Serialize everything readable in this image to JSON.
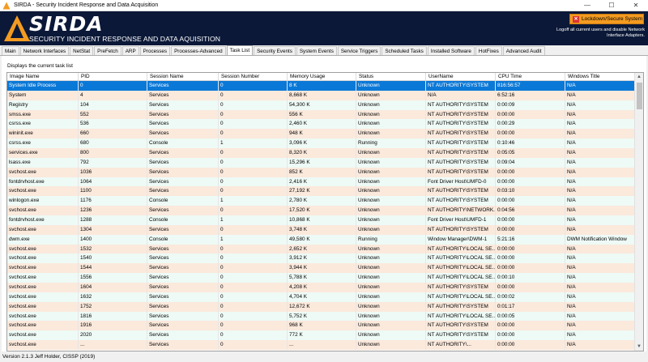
{
  "window": {
    "title": "SIRDA - Security Incident Response and Data Acquisition",
    "minimize": "—",
    "maximize": "☐",
    "close": "✕"
  },
  "banner": {
    "brand": "SIRDA",
    "subtitle": "SECURITY INCIDENT RESPONSE AND DATA AQUISITION",
    "lockdown_label": "Lockdown/Secure System",
    "lockdown_note": "Logoff all current users and disable Network Interface Adapters.",
    "colors": {
      "background": "#0b1838",
      "logo": "#f39b21",
      "lockdown": "#f39b21"
    }
  },
  "tabs": [
    {
      "label": "Main"
    },
    {
      "label": "Network Interfaces"
    },
    {
      "label": "NetStat"
    },
    {
      "label": "PreFetch"
    },
    {
      "label": "ARP"
    },
    {
      "label": "Processes"
    },
    {
      "label": "Processes-Advanced"
    },
    {
      "label": "Task List",
      "active": true
    },
    {
      "label": "Security Events"
    },
    {
      "label": "System Events"
    },
    {
      "label": "Service Triggers"
    },
    {
      "label": "Scheduled Tasks"
    },
    {
      "label": "Installed Software"
    },
    {
      "label": "HotFixes"
    },
    {
      "label": "Advanced Audit"
    }
  ],
  "panel": {
    "description": "Displays the current task list"
  },
  "table": {
    "columns": [
      "Image Name",
      "PID",
      "Session Name",
      "Session Number",
      "Memory Usage",
      "Status",
      "UserName",
      "CPU Time",
      "Windows Title"
    ],
    "rows": [
      [
        "System Idle Process",
        "0",
        "Services",
        "0",
        "8 K",
        "Unknown",
        "NT AUTHORITY\\SYSTEM",
        "816:56:57",
        "N/A"
      ],
      [
        "System",
        "4",
        "Services",
        "0",
        "8,668 K",
        "Unknown",
        "N/A",
        "6:52:16",
        "N/A"
      ],
      [
        "Registry",
        "104",
        "Services",
        "0",
        "54,300 K",
        "Unknown",
        "NT AUTHORITY\\SYSTEM",
        "0:00:09",
        "N/A"
      ],
      [
        "smss.exe",
        "552",
        "Services",
        "0",
        "556 K",
        "Unknown",
        "NT AUTHORITY\\SYSTEM",
        "0:00:00",
        "N/A"
      ],
      [
        "csrss.exe",
        "536",
        "Services",
        "0",
        "2,460 K",
        "Unknown",
        "NT AUTHORITY\\SYSTEM",
        "0:00:29",
        "N/A"
      ],
      [
        "wininit.exe",
        "660",
        "Services",
        "0",
        "948 K",
        "Unknown",
        "NT AUTHORITY\\SYSTEM",
        "0:00:00",
        "N/A"
      ],
      [
        "csrss.exe",
        "680",
        "Console",
        "1",
        "3,096 K",
        "Running",
        "NT AUTHORITY\\SYSTEM",
        "0:10:46",
        "N/A"
      ],
      [
        "services.exe",
        "800",
        "Services",
        "0",
        "8,320 K",
        "Unknown",
        "NT AUTHORITY\\SYSTEM",
        "0:05:05",
        "N/A"
      ],
      [
        "lsass.exe",
        "792",
        "Services",
        "0",
        "15,296 K",
        "Unknown",
        "NT AUTHORITY\\SYSTEM",
        "0:09:04",
        "N/A"
      ],
      [
        "svchost.exe",
        "1036",
        "Services",
        "0",
        "852 K",
        "Unknown",
        "NT AUTHORITY\\SYSTEM",
        "0:00:00",
        "N/A"
      ],
      [
        "fontdrvhost.exe",
        "1064",
        "Services",
        "0",
        "2,416 K",
        "Unknown",
        "Font Driver Host\\UMFD-0",
        "0:00:00",
        "N/A"
      ],
      [
        "svchost.exe",
        "1100",
        "Services",
        "0",
        "27,192 K",
        "Unknown",
        "NT AUTHORITY\\SYSTEM",
        "0:03:10",
        "N/A"
      ],
      [
        "winlogon.exe",
        "1176",
        "Console",
        "1",
        "2,780 K",
        "Unknown",
        "NT AUTHORITY\\SYSTEM",
        "0:00:00",
        "N/A"
      ],
      [
        "svchost.exe",
        "1236",
        "Services",
        "0",
        "17,520 K",
        "Unknown",
        "NT AUTHORITY\\NETWORK...",
        "0:04:56",
        "N/A"
      ],
      [
        "fontdrvhost.exe",
        "1288",
        "Console",
        "1",
        "10,868 K",
        "Unknown",
        "Font Driver Host\\UMFD-1",
        "0:00:00",
        "N/A"
      ],
      [
        "svchost.exe",
        "1304",
        "Services",
        "0",
        "3,748 K",
        "Unknown",
        "NT AUTHORITY\\SYSTEM",
        "0:00:00",
        "N/A"
      ],
      [
        "dwm.exe",
        "1400",
        "Console",
        "1",
        "49,580 K",
        "Running",
        "Window Manager\\DWM-1",
        "5:21:16",
        "DWM Notification Window"
      ],
      [
        "svchost.exe",
        "1532",
        "Services",
        "0",
        "2,652 K",
        "Unknown",
        "NT AUTHORITY\\LOCAL SE...",
        "0:00:00",
        "N/A"
      ],
      [
        "svchost.exe",
        "1540",
        "Services",
        "0",
        "3,912 K",
        "Unknown",
        "NT AUTHORITY\\LOCAL SE...",
        "0:00:00",
        "N/A"
      ],
      [
        "svchost.exe",
        "1544",
        "Services",
        "0",
        "3,944 K",
        "Unknown",
        "NT AUTHORITY\\LOCAL SE...",
        "0:00:00",
        "N/A"
      ],
      [
        "svchost.exe",
        "1556",
        "Services",
        "0",
        "5,788 K",
        "Unknown",
        "NT AUTHORITY\\LOCAL SE...",
        "0:00:10",
        "N/A"
      ],
      [
        "svchost.exe",
        "1604",
        "Services",
        "0",
        "4,208 K",
        "Unknown",
        "NT AUTHORITY\\SYSTEM",
        "0:00:00",
        "N/A"
      ],
      [
        "svchost.exe",
        "1632",
        "Services",
        "0",
        "4,704 K",
        "Unknown",
        "NT AUTHORITY\\LOCAL SE...",
        "0:00:02",
        "N/A"
      ],
      [
        "svchost.exe",
        "1752",
        "Services",
        "0",
        "12,672 K",
        "Unknown",
        "NT AUTHORITY\\SYSTEM",
        "0:01:17",
        "N/A"
      ],
      [
        "svchost.exe",
        "1816",
        "Services",
        "0",
        "5,752 K",
        "Unknown",
        "NT AUTHORITY\\LOCAL SE...",
        "0:00:05",
        "N/A"
      ],
      [
        "svchost.exe",
        "1916",
        "Services",
        "0",
        "968 K",
        "Unknown",
        "NT AUTHORITY\\SYSTEM",
        "0:00:00",
        "N/A"
      ],
      [
        "svchost.exe",
        "2020",
        "Services",
        "0",
        "772 K",
        "Unknown",
        "NT AUTHORITY\\SYSTEM",
        "0:00:00",
        "N/A"
      ],
      [
        "svchost.exe",
        "...",
        "Services",
        "0",
        "...",
        "Unknown",
        "NT AUTHORITY\\...",
        "0:00:00",
        "N/A"
      ]
    ],
    "selected_row": 0,
    "colors": {
      "selected": "#0a78d7",
      "odd": "#fbe9dc",
      "even": "#eefaf6"
    }
  },
  "status": {
    "text": "Version 2.1.3   Jeff Holder, CISSP (2019)"
  }
}
